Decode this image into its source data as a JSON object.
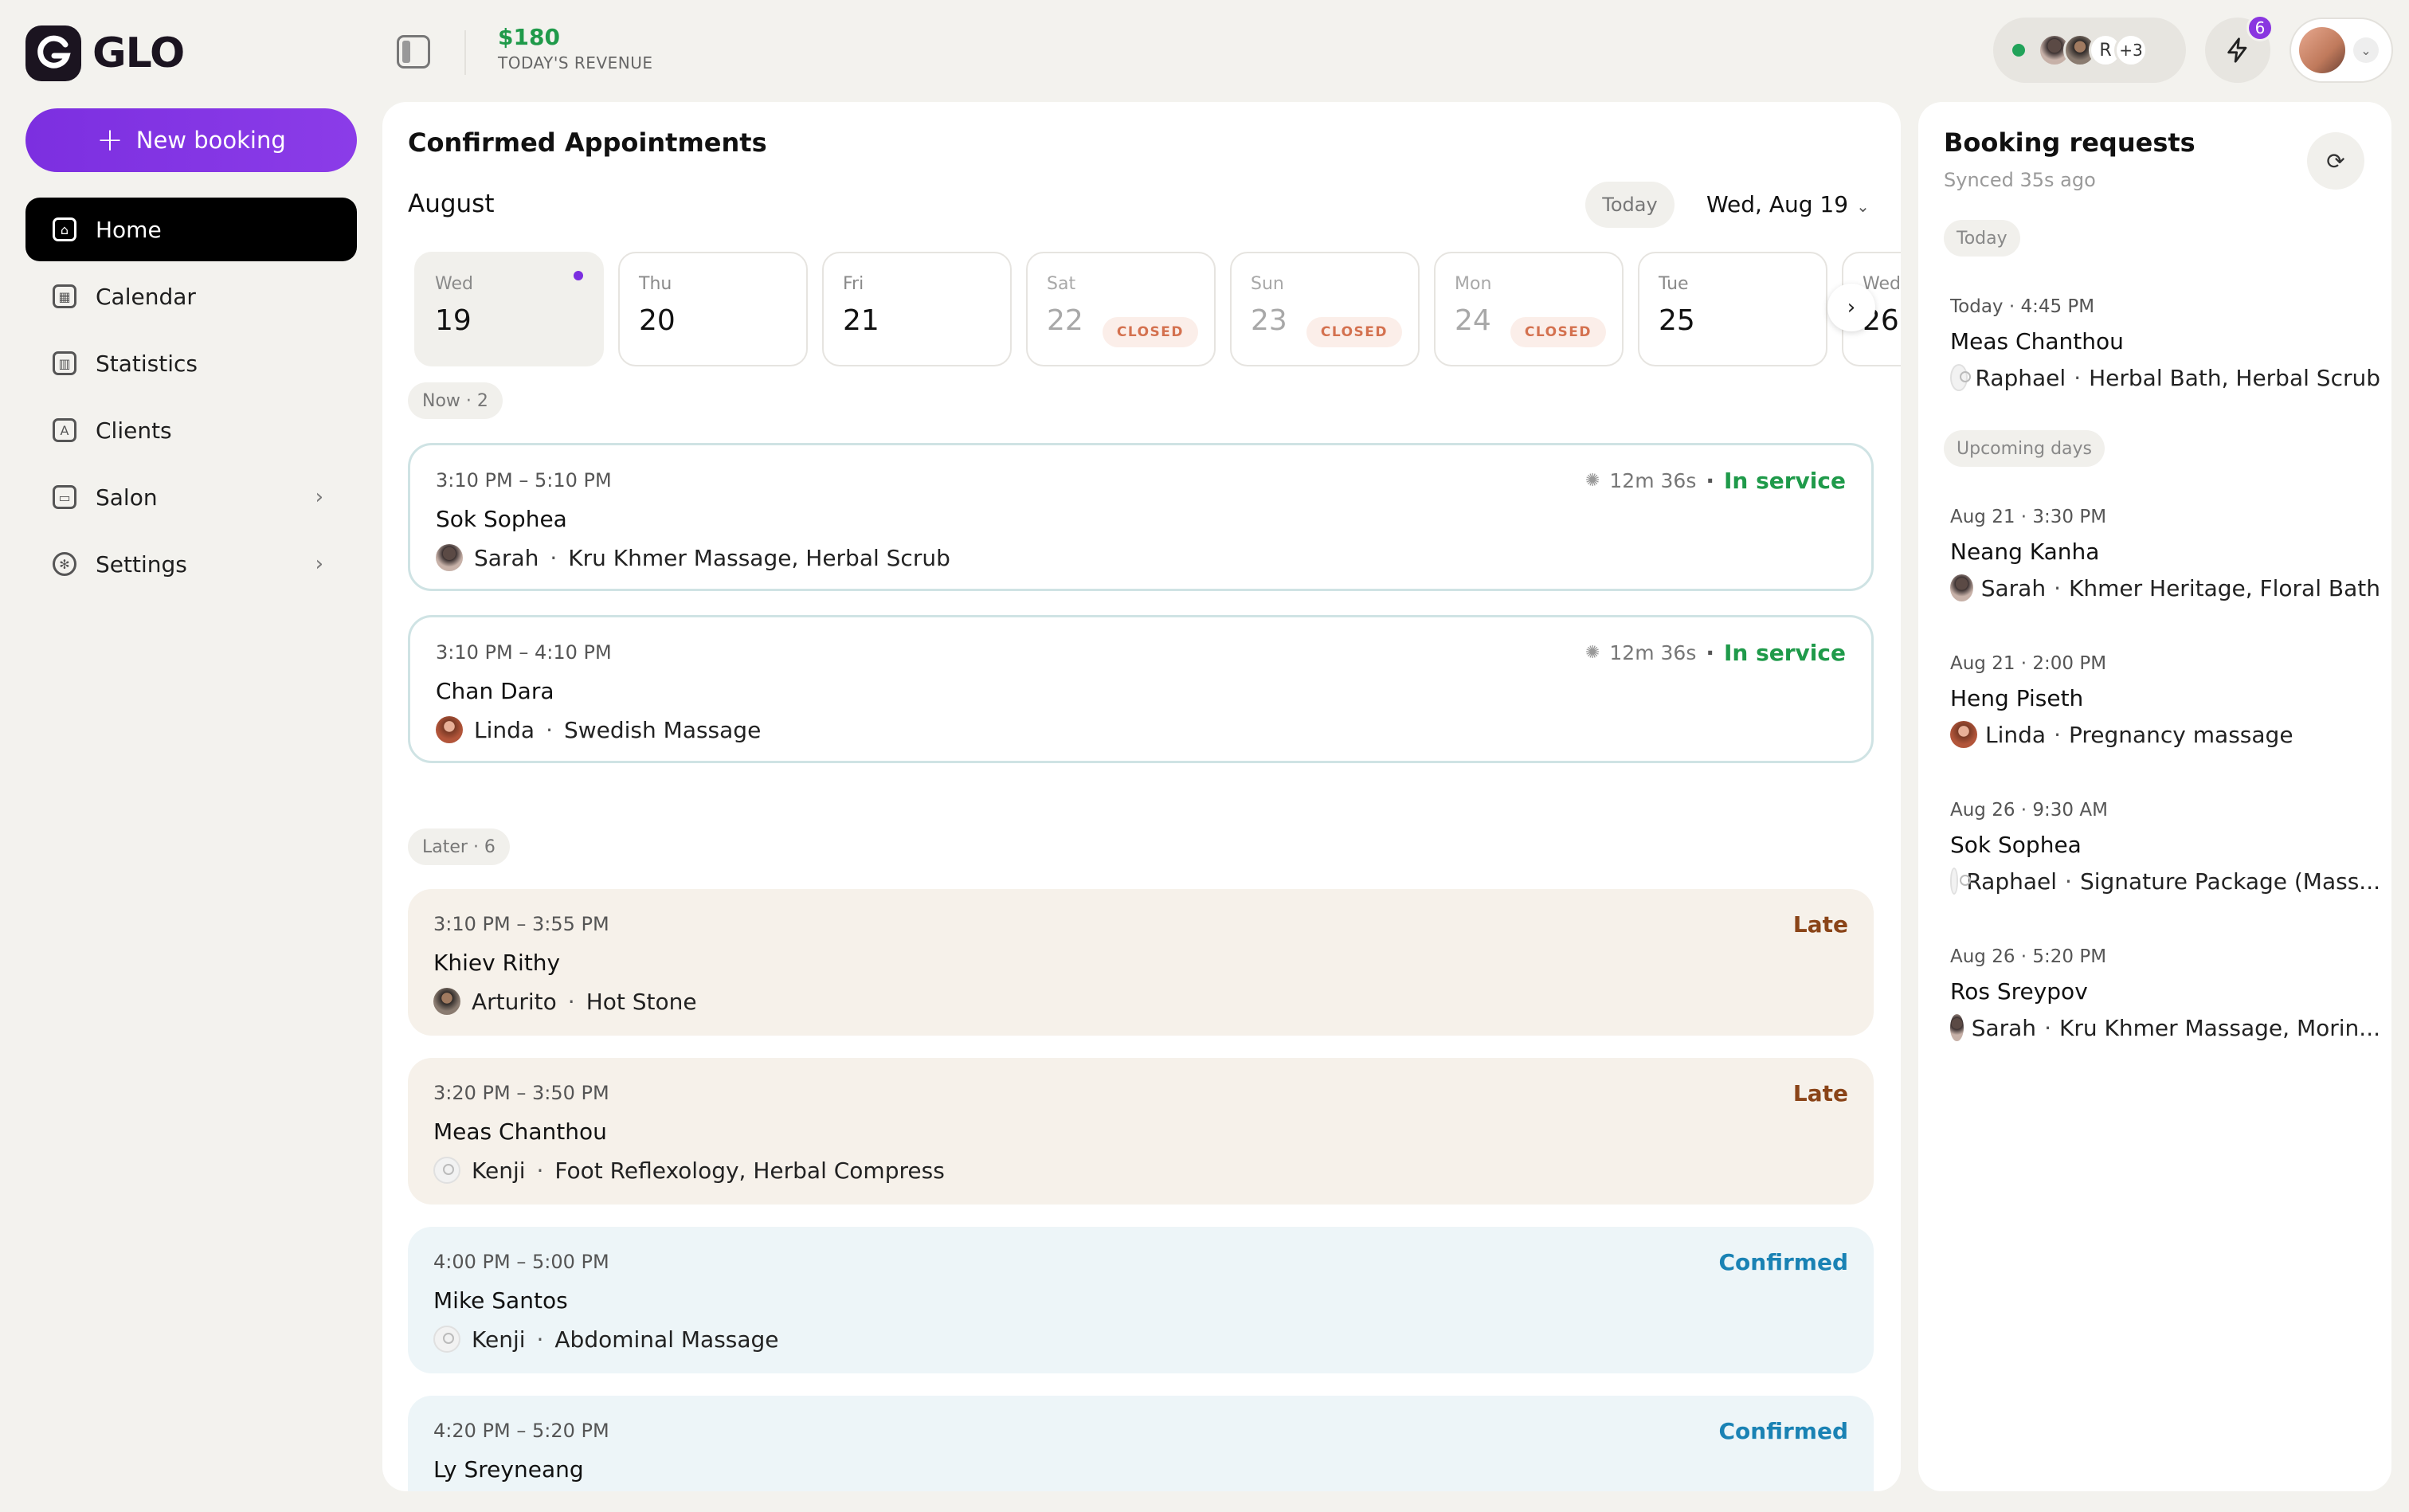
{
  "brand": {
    "name": "GLO"
  },
  "header": {
    "revenue_amount": "$180",
    "revenue_label": "TODAY'S REVENUE",
    "staff_initial": "R",
    "staff_more": "+3",
    "notification_count": "6"
  },
  "sidebar": {
    "new_booking": "New booking",
    "items": [
      {
        "label": "Home",
        "icon": "home-icon"
      },
      {
        "label": "Calendar",
        "icon": "calendar-icon"
      },
      {
        "label": "Statistics",
        "icon": "chart-icon"
      },
      {
        "label": "Clients",
        "icon": "contacts-icon"
      },
      {
        "label": "Salon",
        "icon": "store-icon"
      },
      {
        "label": "Settings",
        "icon": "gear-icon"
      }
    ]
  },
  "main": {
    "title": "Confirmed Appointments",
    "month": "August",
    "today_button": "Today",
    "selected_date": "Wed, Aug 19",
    "days": [
      {
        "name": "Wed",
        "date": "19",
        "closed": ""
      },
      {
        "name": "Thu",
        "date": "20",
        "closed": ""
      },
      {
        "name": "Fri",
        "date": "21",
        "closed": ""
      },
      {
        "name": "Sat",
        "date": "22",
        "closed": "CLOSED"
      },
      {
        "name": "Sun",
        "date": "23",
        "closed": "CLOSED"
      },
      {
        "name": "Mon",
        "date": "24",
        "closed": "CLOSED"
      },
      {
        "name": "Tue",
        "date": "25",
        "closed": ""
      },
      {
        "name": "Wed",
        "date": "26",
        "closed": ""
      }
    ],
    "now_label": "Now · 2",
    "later_label": "Later · 6",
    "now": [
      {
        "time": "3:10 PM – 5:10 PM",
        "client": "Sok Sophea",
        "staff": "Sarah",
        "service": "Kru Khmer Massage, Herbal Scrub",
        "timer": "12m 36s",
        "status": "In service"
      },
      {
        "time": "3:10 PM – 4:10 PM",
        "client": "Chan Dara",
        "staff": "Linda",
        "service": "Swedish Massage",
        "timer": "12m 36s",
        "status": "In service"
      }
    ],
    "later": [
      {
        "time": "3:10 PM – 3:55 PM",
        "client": "Khiev Rithy",
        "staff": "Arturito",
        "service": "Hot Stone",
        "status": "Late"
      },
      {
        "time": "3:20 PM – 3:50 PM",
        "client": "Meas Chanthou",
        "staff": "Kenji",
        "service": "Foot Reflexology, Herbal Compress",
        "status": "Late"
      },
      {
        "time": "4:00 PM – 5:00 PM",
        "client": "Mike Santos",
        "staff": "Kenji",
        "service": "Abdominal Massage",
        "status": "Confirmed"
      },
      {
        "time": "4:20 PM – 5:20 PM",
        "client": "Ly Sreyneang",
        "status": "Confirmed"
      }
    ]
  },
  "requests": {
    "title": "Booking requests",
    "synced": "Synced 35s ago",
    "today_label": "Today",
    "upcoming_label": "Upcoming days",
    "today": [
      {
        "time": "Today · 4:45 PM",
        "client": "Meas Chanthou",
        "staff": "Raphael",
        "service": "Herbal Bath, Herbal Scrub"
      }
    ],
    "upcoming": [
      {
        "time": "Aug 21 · 3:30 PM",
        "client": "Neang Kanha",
        "staff": "Sarah",
        "service": "Khmer Heritage, Floral Bath"
      },
      {
        "time": "Aug 21 · 2:00 PM",
        "client": "Heng Piseth",
        "staff": "Linda",
        "service": "Pregnancy massage"
      },
      {
        "time": "Aug 26 · 9:30 AM",
        "client": "Sok Sophea",
        "staff": "Raphael",
        "service": "Signature Package (Mass..."
      },
      {
        "time": "Aug 26 · 5:20 PM",
        "client": "Ros Sreypov",
        "staff": "Sarah",
        "service": "Kru Khmer Massage, Morin..."
      }
    ]
  },
  "colors": {
    "accent": "#7c2fe0",
    "in_service": "#1f9a4a",
    "late": "#8a4418",
    "confirmed": "#1a82b4",
    "closed": "#d4714f"
  }
}
